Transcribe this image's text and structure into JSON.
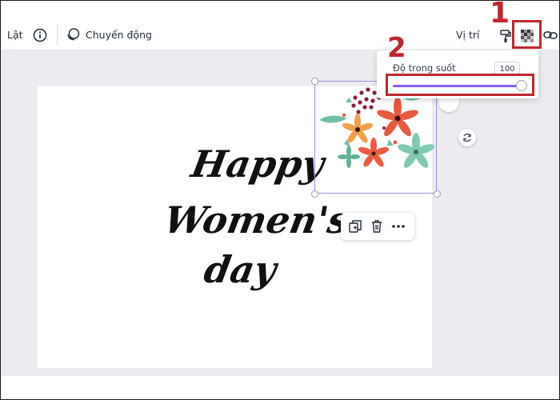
{
  "toolbar": {
    "flip_label": "Lật",
    "info_icon": "info-icon",
    "animate_icon": "animate-icon",
    "animate_label": "Chuyển động",
    "position_label": "Vị trí",
    "paint_icon": "paint-roller-icon",
    "transparency_icon": "transparency-icon",
    "link_icon": "link-icon"
  },
  "annotations": {
    "marker_1": "1",
    "marker_2": "2",
    "color": "#c0262d"
  },
  "transparency_popover": {
    "label": "Độ trong suốt",
    "value": "100",
    "slider_level": 1.0,
    "slider_color": "#8b5cf6"
  },
  "canvas": {
    "text_lines": [
      "Happy",
      "Women's",
      "day"
    ]
  },
  "element_menu": {
    "duplicate_icon": "duplicate-icon",
    "delete_icon": "trash-icon",
    "more_icon": "more-icon"
  },
  "colors": {
    "workspace": "#ebecf0",
    "selection": "#a78bdb"
  }
}
